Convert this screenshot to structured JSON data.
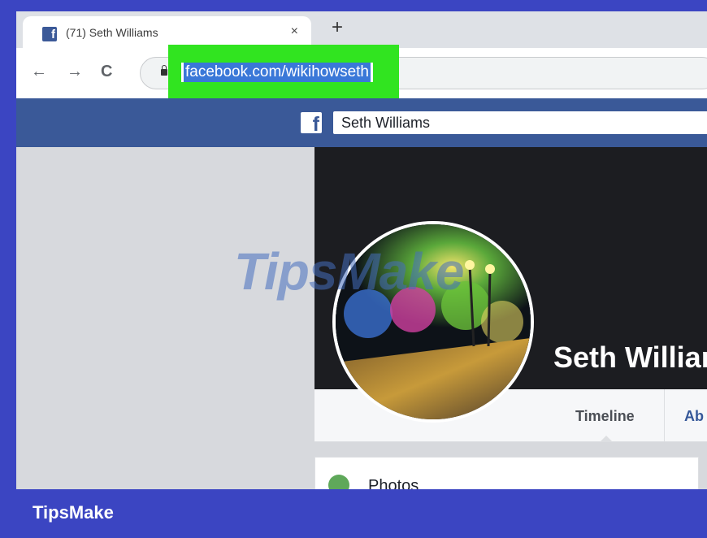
{
  "browser": {
    "tab_title": "(71) Seth Williams",
    "close_glyph": "×",
    "new_tab_glyph": "+",
    "back_glyph": "←",
    "forward_glyph": "→",
    "reload_glyph": "C",
    "url": "facebook.com/wikihowseth"
  },
  "facebook": {
    "logo": "f",
    "search_value": "Seth Williams",
    "profile_name": "Seth Williar",
    "tabs": [
      "Timeline",
      "Ab"
    ],
    "photos_label": "Photos"
  },
  "watermark": "TipsMake",
  "footer": {
    "brand": "TipsMake"
  },
  "colors": {
    "frame_blue": "#3b45c2",
    "highlight_green": "#31e420",
    "facebook_blue": "#3a5998",
    "url_selection": "#3a78d8"
  }
}
